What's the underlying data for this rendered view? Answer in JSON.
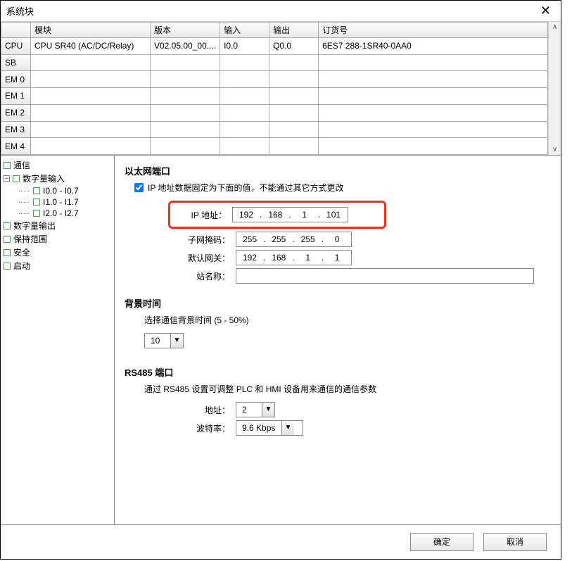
{
  "window": {
    "title": "系统块"
  },
  "grid": {
    "headers": {
      "module": "模块",
      "version": "版本",
      "input": "输入",
      "output": "输出",
      "order": "订货号"
    },
    "rows": [
      {
        "slot": "CPU",
        "module": "CPU SR40 (AC/DC/Relay)",
        "version": "V02.05.00_00....",
        "input": "I0.0",
        "output": "Q0.0",
        "order": "6ES7 288-1SR40-0AA0"
      },
      {
        "slot": "SB",
        "module": "",
        "version": "",
        "input": "",
        "output": "",
        "order": ""
      },
      {
        "slot": "EM 0",
        "module": "",
        "version": "",
        "input": "",
        "output": "",
        "order": ""
      },
      {
        "slot": "EM 1",
        "module": "",
        "version": "",
        "input": "",
        "output": "",
        "order": ""
      },
      {
        "slot": "EM 2",
        "module": "",
        "version": "",
        "input": "",
        "output": "",
        "order": ""
      },
      {
        "slot": "EM 3",
        "module": "",
        "version": "",
        "input": "",
        "output": "",
        "order": ""
      },
      {
        "slot": "EM 4",
        "module": "",
        "version": "",
        "input": "",
        "output": "",
        "order": ""
      }
    ]
  },
  "tree": {
    "comm": "通信",
    "din": "数字量输入",
    "din_items": [
      "I0.0 - I0.7",
      "I1.0 - I1.7",
      "I2.0 - I2.7"
    ],
    "dout": "数字量输出",
    "retain": "保持范围",
    "safety": "安全",
    "startup": "启动"
  },
  "ethernet": {
    "title": "以太网端口",
    "fixed_label": "IP 地址数据固定为下面的值，不能通过其它方式更改",
    "ip_label": "IP 地址：",
    "ip": [
      "192",
      "168",
      "1",
      "101"
    ],
    "mask_label": "子网掩码：",
    "mask": [
      "255",
      "255",
      "255",
      "0"
    ],
    "gw_label": "默认网关：",
    "gw": [
      "192",
      "168",
      "1",
      "1"
    ],
    "station_label": "站名称："
  },
  "bgtime": {
    "title": "背景时间",
    "note": "选择通信背景时间 (5 - 50%)",
    "value": "10"
  },
  "rs485": {
    "title": "RS485  端口",
    "note": "通过 RS485 设置可调整 PLC 和 HMI 设备用来通信的通信参数",
    "addr_label": "地址：",
    "addr_value": "2",
    "baud_label": "波特率：",
    "baud_value": "9.6 Kbps"
  },
  "buttons": {
    "ok": "确定",
    "cancel": "取消"
  }
}
